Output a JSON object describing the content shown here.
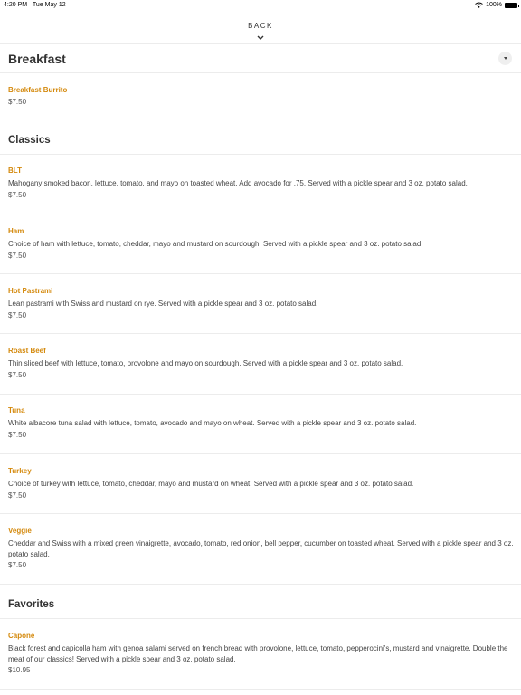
{
  "status_bar": {
    "time": "4:20 PM",
    "date": "Tue May 12",
    "battery": "100%"
  },
  "nav": {
    "back_label": "BACK"
  },
  "sections": {
    "breakfast": {
      "title": "Breakfast",
      "items": [
        {
          "name": "Breakfast Burrito",
          "price": "$7.50"
        }
      ]
    },
    "classics": {
      "title": "Classics",
      "items": [
        {
          "name": "BLT",
          "description": "Mahogany smoked bacon, lettuce, tomato, and mayo on toasted wheat. Add avocado for .75. Served with a pickle spear and 3 oz. potato salad.",
          "price": "$7.50"
        },
        {
          "name": "Ham",
          "description": "Choice of ham with lettuce, tomato, cheddar, mayo and mustard on sourdough. Served with a pickle spear and 3 oz. potato salad.",
          "price": "$7.50"
        },
        {
          "name": "Hot Pastrami",
          "description": "Lean pastrami with Swiss and mustard on rye. Served with a pickle spear and 3 oz. potato salad.",
          "price": "$7.50"
        },
        {
          "name": "Roast Beef",
          "description": "Thin sliced beef with lettuce, tomato, provolone and mayo on sourdough. Served with a pickle spear and 3 oz. potato salad.",
          "price": "$7.50"
        },
        {
          "name": "Tuna",
          "description": "White albacore tuna salad with lettuce, tomato, avocado and mayo on wheat. Served with a pickle spear and 3 oz. potato salad.",
          "price": "$7.50"
        },
        {
          "name": "Turkey",
          "description": "Choice of turkey with lettuce, tomato, cheddar, mayo and mustard on wheat. Served with a pickle spear and 3 oz. potato salad.",
          "price": "$7.50"
        },
        {
          "name": "Veggie",
          "description": "Cheddar and Swiss with a mixed green vinaigrette, avocado, tomato, red onion, bell pepper, cucumber on toasted wheat. Served with a pickle spear and 3 oz. potato salad.",
          "price": "$7.50"
        }
      ]
    },
    "favorites": {
      "title": "Favorites",
      "items": [
        {
          "name": "Capone",
          "description": "Black forest and capicolla ham with genoa salami served on french bread with provolone, lettuce, tomato, pepperocini's, mustard and vinaigrette. Double the meat of our classics! Served with a pickle spear and 3 oz. potato salad.",
          "price": "$10.95"
        }
      ]
    }
  },
  "colors": {
    "accent": "#d4890c",
    "text": "#333333",
    "divider": "#ececec"
  }
}
